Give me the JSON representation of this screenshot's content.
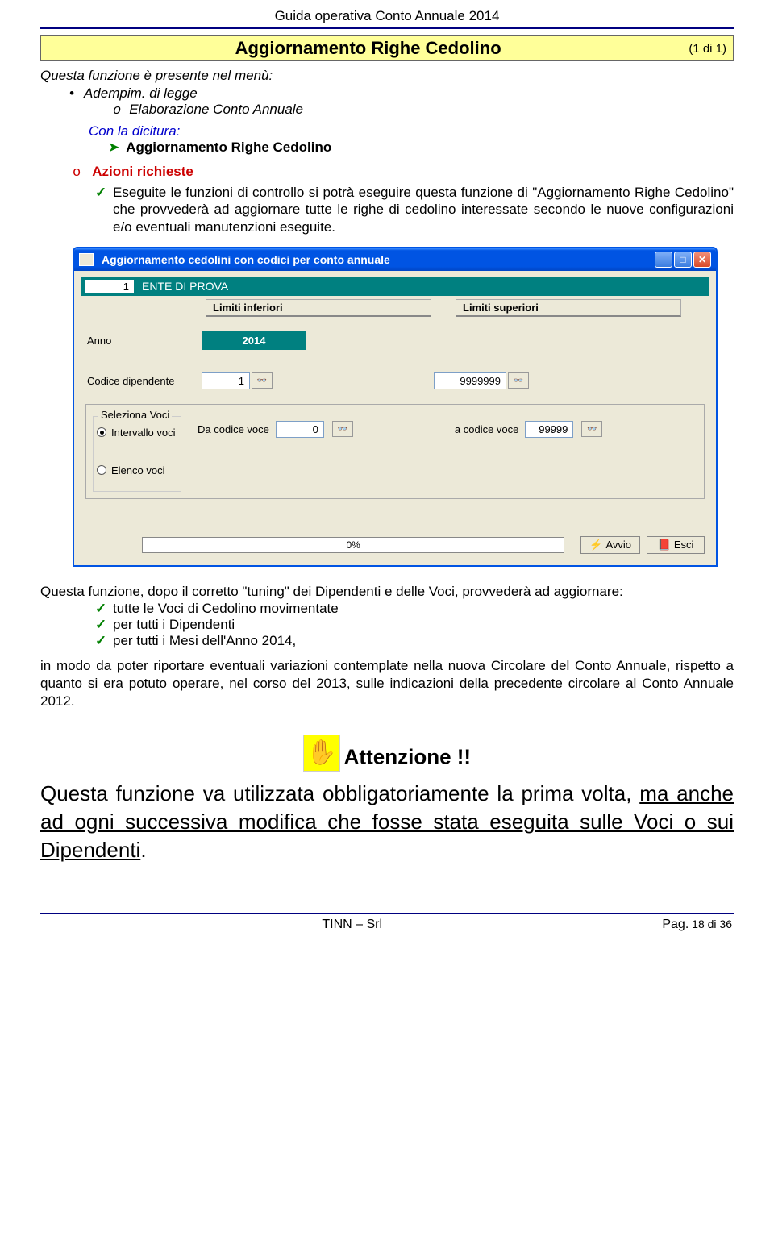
{
  "header": {
    "title": "Guida operativa  Conto Annuale 2014"
  },
  "titlebar": {
    "center": "Aggiornamento Righe Cedolino",
    "right": "(1 di 1)"
  },
  "intro": {
    "line1": "Questa funzione è presente nel menù:",
    "bullet": "Adempim. di legge",
    "subbullet": "Elaborazione Conto Annuale",
    "con_la": "Con la dicitura:",
    "arrow_bold": "Aggiornamento Righe Cedolino"
  },
  "azioni": {
    "label": "Azioni richieste",
    "para": "Eseguite le funzioni di controllo si potrà eseguire questa funzione di \"Aggiornamento Righe Cedolino\" che provvederà ad aggiornare tutte le righe di cedolino interessate secondo le nuove configurazioni e/o eventuali manutenzioni eseguite."
  },
  "xp": {
    "title": "Aggiornamento cedolini con codici per conto annuale",
    "ente_num": "1",
    "ente_name": "ENTE DI PROVA",
    "limits_inf": "Limiti inferiori",
    "limits_sup": "Limiti superiori",
    "anno_label": "Anno",
    "anno_value": "2014",
    "codice_dip_label": "Codice dipendente",
    "codice_dip_from": "1",
    "codice_dip_to": "9999999",
    "group_legend": "Seleziona Voci",
    "radio1": "Intervallo voci",
    "radio2": "Elenco voci",
    "da_codice_label": "Da codice voce",
    "da_codice_val": "0",
    "a_codice_label": "a codice voce",
    "a_codice_val": "99999",
    "progress": "0%",
    "avvio": "Avvio",
    "esci": "Esci"
  },
  "after": {
    "intro": "Questa funzione,  dopo il corretto \"tuning\" dei Dipendenti e delle Voci,  provvederà ad aggiornare:",
    "li1": "tutte le Voci di Cedolino movimentate",
    "li2": "per tutti i Dipendenti",
    "li3": "per tutti i Mesi dell'Anno 2014,",
    "para": "in modo da poter riportare eventuali variazioni contemplate nella nuova Circolare del Conto Annuale, rispetto a quanto si era potuto operare, nel corso del 2013, sulle indicazioni della precedente circolare al Conto Annuale 2012."
  },
  "attention": {
    "label": "Attenzione !!",
    "big1": "Questa funzione va utilizzata obbligatoriamente la prima volta, ",
    "big_underline": "ma anche ad ogni successiva modifica che fosse stata eseguita sulle Voci o sui Dipendenti",
    "big_end": "."
  },
  "footer": {
    "center": "TINN – Srl",
    "right_label": "Pag.",
    "right_num": " 18 di 36"
  }
}
